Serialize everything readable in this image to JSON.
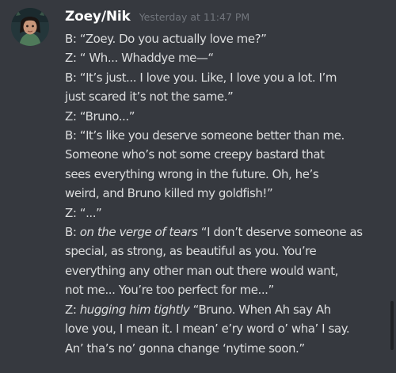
{
  "message": {
    "author": "Zoey/Nik",
    "timestamp": "Yesterday at 11:47 PM",
    "avatar_icon": "character-avatar",
    "lines": [
      {
        "text": "B: “Zoey. Do you actually love me?”"
      },
      {
        "text": "Z: “ Wh... Whaddye me—“"
      },
      {
        "text": "B: “It’s just... I love you. Like, I love you a lot. I’m"
      },
      {
        "text": "just scared it’s not the same.”"
      },
      {
        "text": "Z: “Bruno...”"
      },
      {
        "text": "B: “It’s like you deserve someone better than me."
      },
      {
        "text": "Someone who’s not some creepy bastard that"
      },
      {
        "text": "sees everything wrong in the future. Oh, he’s"
      },
      {
        "text": "weird, and Bruno killed my goldfish!”"
      },
      {
        "text": "Z: “...”"
      },
      {
        "prefix": "B: ",
        "italic": "on the verge of tears",
        "text": " “I don’t deserve someone as"
      },
      {
        "text": "special, as strong, as beautiful as you. You’re"
      },
      {
        "text": "everything any other man out there would want,"
      },
      {
        "text": "not me... You’re too perfect for me...”"
      },
      {
        "prefix": "Z: ",
        "italic": "hugging him tightly",
        "text": " “Bruno. When Ah say Ah"
      },
      {
        "text": "love you, I mean it. I mean’ e’ry word o’ wha’ I say."
      },
      {
        "text": "An’ tha’s no’ gonna change ‘nytime soon.”"
      }
    ]
  },
  "colors": {
    "background": "#36393f",
    "username": "#ffffff",
    "timestamp": "#72767d",
    "text": "#dcddde",
    "scrollbar": "#202225"
  }
}
